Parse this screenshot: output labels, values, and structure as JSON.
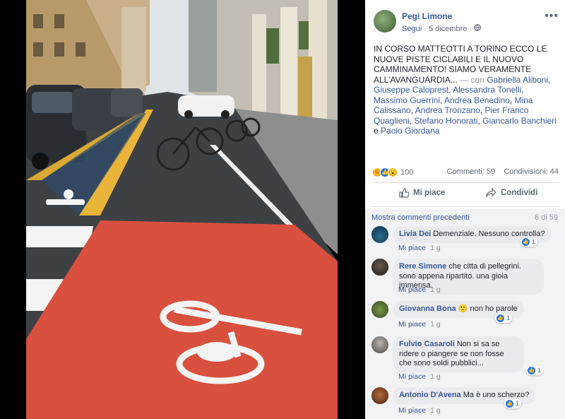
{
  "post": {
    "author": "Pegi Limone",
    "follow_label": "Segui",
    "date": "5 dicembre",
    "text_main": "IN CORSO MATTEOTTI A TORINO ECCO LE NUOVE PISTE CICLABILI E IL NUOVO CAMMINAMENTO! SIAMO VERAMENTE ALL’AVANGUARDIA...",
    "with_label": "— con",
    "tagged": [
      "Gabriella Aliboni",
      "Giuseppe Caloprest",
      "Alessandra Tonelli",
      "Massimo Guerrini",
      "Andrea Benedino",
      "Mina Calissano",
      "Andrea Tronzano",
      "Pier Franco Quaglieni",
      "Stefano Honorati",
      "Giancarlo Banchieri"
    ],
    "and_label": "e",
    "last_tagged": "Paolo Giordana",
    "reactions_count": "100",
    "comments_count": "Commenti: 59",
    "shares_count": "Condivisioni: 44",
    "like_label": "Mi piace",
    "share_label": "Condividi"
  },
  "comments_section": {
    "more_label": "Mostra commenti precedenti",
    "counter": "6 di 59",
    "items": [
      {
        "author": "Livia Dei",
        "text": "Demenziale. Nessuno controlla?",
        "like_label": "Mi piace",
        "time": "1 g",
        "reactions": "1"
      },
      {
        "author": "Rere Simone",
        "text": "che citta di pellegrini. sono appena ripartito. una gioia immensa.",
        "like_label": "Mi piace",
        "time": "1 g",
        "reactions": ""
      },
      {
        "author": "Giovanna Bona",
        "text": "non ho parole",
        "emoji": "🙁",
        "like_label": "Mi piace",
        "time": "1 g",
        "reactions": "1"
      },
      {
        "author": "Fulvio Casaroli",
        "text": "Non si sa se ridere o piangere se non fosse che sono soldi pubblici...",
        "like_label": "Mi piace",
        "time": "1 g",
        "reactions": "1"
      },
      {
        "author": "Antonio D'Avena",
        "text": "Ma è uno scherzo?",
        "like_label": "Mi piace",
        "time": "1 g",
        "reactions": "1"
      }
    ]
  },
  "colors": {
    "link": "#385898",
    "bike_lane": "#d9503e",
    "panel_bg": "#ffffff",
    "comment_bg": "#f2f3f5"
  }
}
